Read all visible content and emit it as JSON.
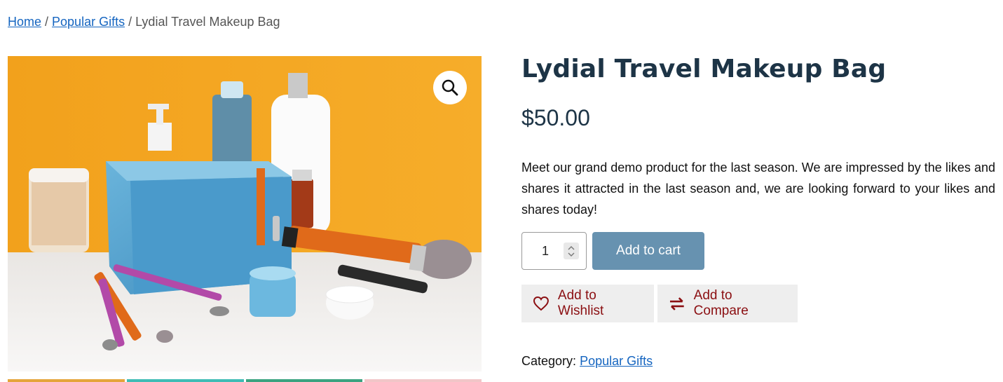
{
  "breadcrumb": {
    "home": "Home",
    "separator1": " / ",
    "category": "Popular Gifts",
    "separator2": " / ",
    "current": "Lydial Travel Makeup Bag"
  },
  "product": {
    "title": "Lydial Travel Makeup Bag",
    "price": "$50.00",
    "description": "Meet our grand demo product for the last season. We are impressed by the likes and shares it attracted in the last season and, we are looking forward to your likes and shares today!"
  },
  "cart": {
    "quantity": "1",
    "add_to_cart_label": "Add to cart"
  },
  "actions": {
    "wishlist_label": "Add to Wishlist",
    "compare_label": "Add to Compare"
  },
  "meta": {
    "category_label": "Category:",
    "category_value": "Popular Gifts"
  },
  "icons": {
    "zoom": "search-icon",
    "wishlist": "heart-icon",
    "compare": "swap-arrows-icon"
  },
  "colors": {
    "title": "#1d3446",
    "link": "#1565c0",
    "add_to_cart_bg": "#6792b0",
    "action_text": "#8b0f12",
    "action_bg": "#eeeeee"
  }
}
